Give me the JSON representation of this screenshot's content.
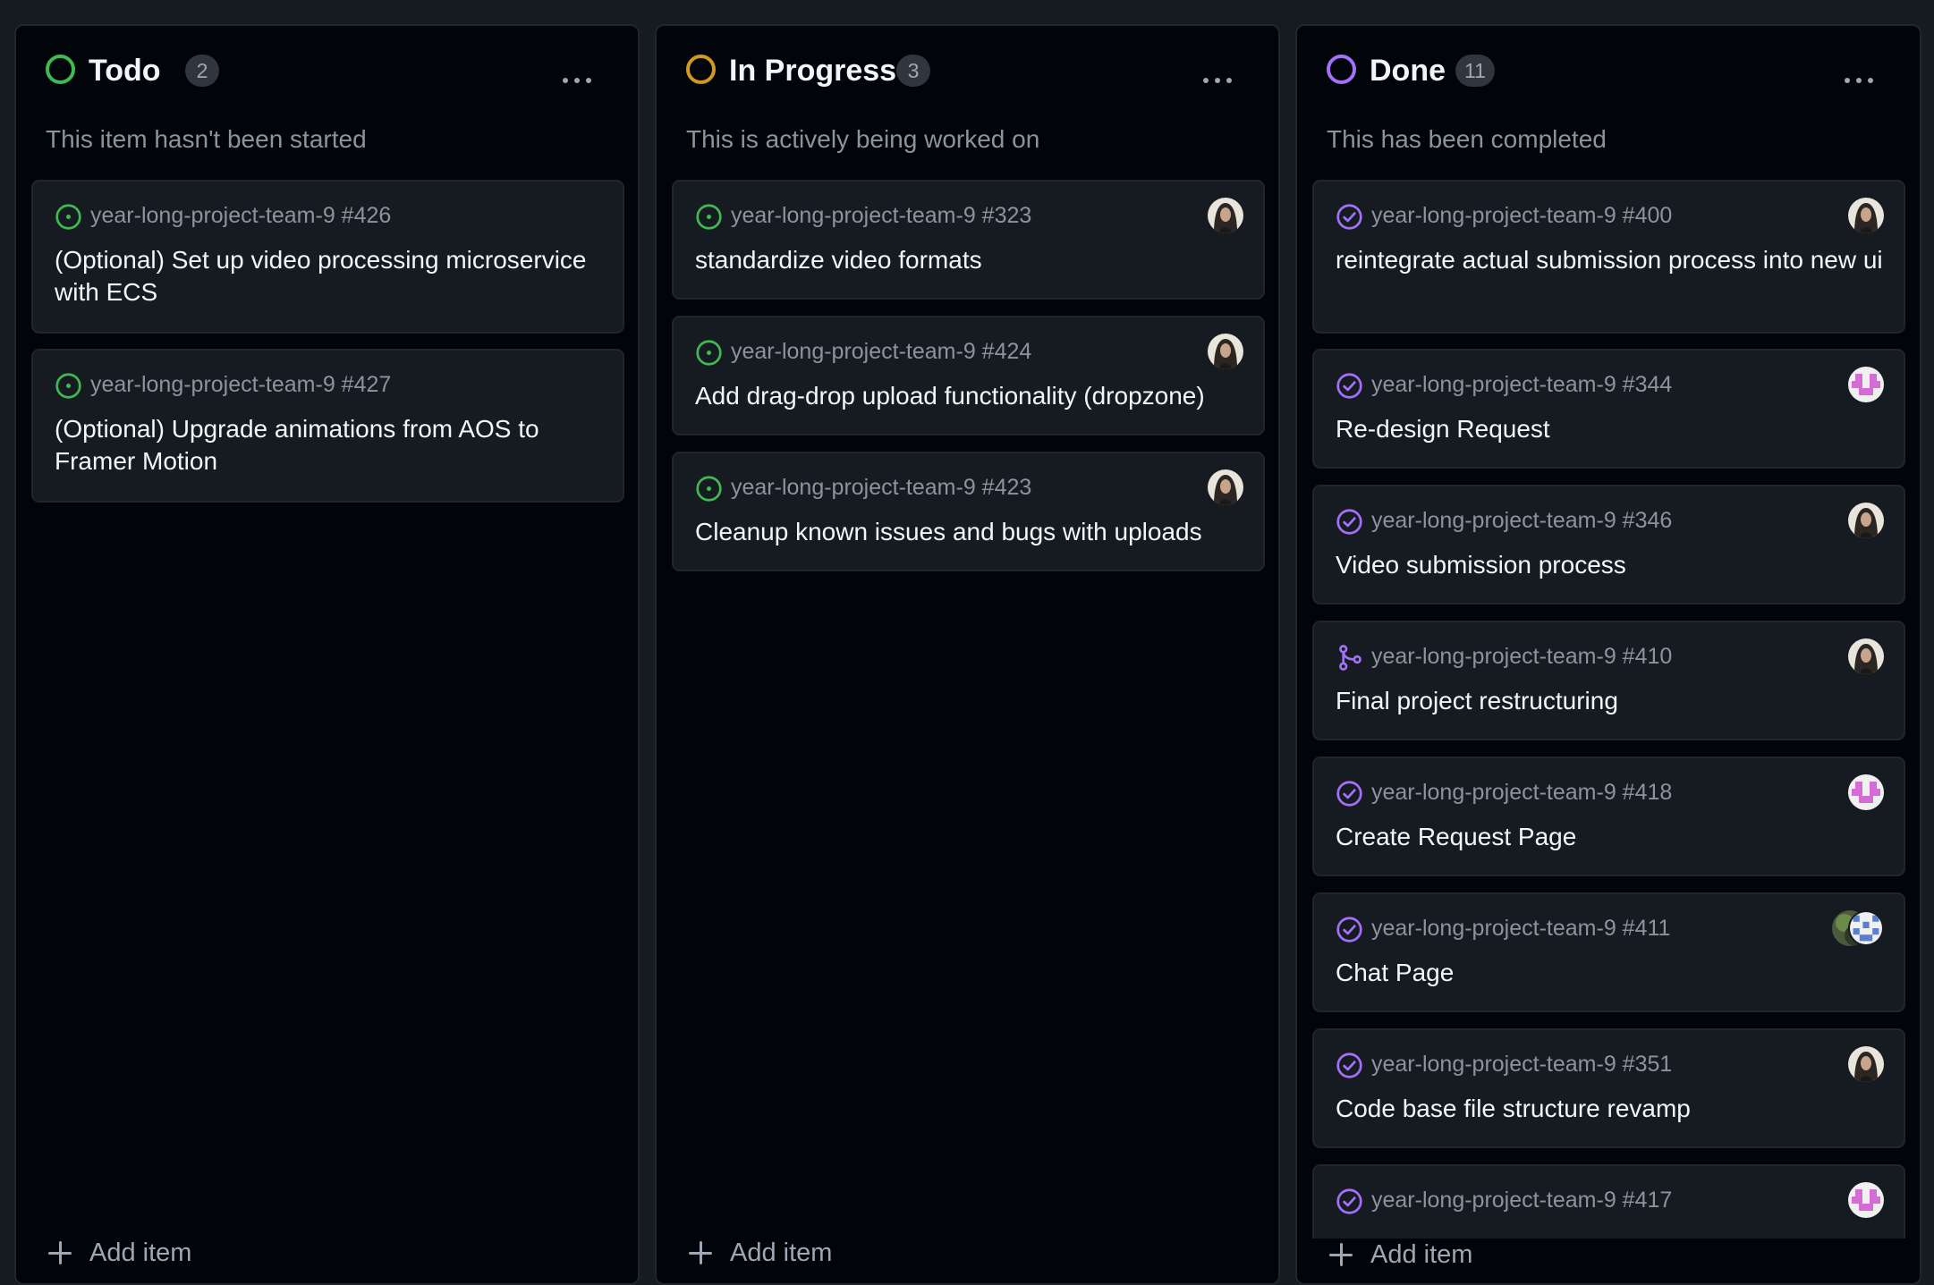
{
  "colors": {
    "background": "#161b22",
    "column_background": "#010409",
    "card_background": "#161b22",
    "todo_status": "#3fb950",
    "in_progress_status": "#d29922",
    "done_status": "#a371f7",
    "open_issue_icon": "#3fb950",
    "closed_issue_icon": "#a371f7",
    "merged_pr_icon": "#a371f7"
  },
  "columns": [
    {
      "title": "Todo",
      "count": "2",
      "status_color": "#3fb950",
      "description": "This item hasn't been started",
      "add_label": "Add item",
      "cards": [
        {
          "ref": "year-long-project-team-9 #426",
          "title": "(Optional) Set up video processing microservice with ECS",
          "icon": "open-issue-icon",
          "avatar": "none"
        },
        {
          "ref": "year-long-project-team-9 #427",
          "title": "(Optional) Upgrade animations from AOS to Framer Motion",
          "icon": "open-issue-icon",
          "avatar": "none"
        }
      ]
    },
    {
      "title": "In Progress",
      "count": "3",
      "status_color": "#d29922",
      "description": "This is actively being worked on",
      "add_label": "Add item",
      "cards": [
        {
          "ref": "year-long-project-team-9 #323",
          "title": "standardize video formats",
          "icon": "open-issue-icon",
          "avatar": "photo"
        },
        {
          "ref": "year-long-project-team-9 #424",
          "title": "Add drag-drop upload functionality (dropzone)",
          "icon": "open-issue-icon",
          "avatar": "photo"
        },
        {
          "ref": "year-long-project-team-9 #423",
          "title": "Cleanup known issues and bugs with uploads",
          "icon": "open-issue-icon",
          "avatar": "photo"
        }
      ]
    },
    {
      "title": "Done",
      "count": "11",
      "status_color": "#a371f7",
      "description": "This has been completed",
      "add_label": "Add item",
      "cards": [
        {
          "ref": "year-long-project-team-9 #400",
          "title": "reintegrate actual submission process into new ui",
          "icon": "closed-issue-icon",
          "avatar": "photo"
        },
        {
          "ref": "year-long-project-team-9 #344",
          "title": "Re-design Request",
          "icon": "closed-issue-icon",
          "avatar": "pink-identicon"
        },
        {
          "ref": "year-long-project-team-9 #346",
          "title": "Video submission process",
          "icon": "closed-issue-icon",
          "avatar": "photo"
        },
        {
          "ref": "year-long-project-team-9 #410",
          "title": "Final project restructuring",
          "icon": "merged-pr-icon",
          "avatar": "photo"
        },
        {
          "ref": "year-long-project-team-9 #418",
          "title": "Create Request Page",
          "icon": "closed-issue-icon",
          "avatar": "pink-identicon"
        },
        {
          "ref": "year-long-project-team-9 #411",
          "title": "Chat Page",
          "icon": "closed-issue-icon",
          "avatar": "avatar-pair"
        },
        {
          "ref": "year-long-project-team-9 #351",
          "title": "Code base file structure revamp",
          "icon": "closed-issue-icon",
          "avatar": "photo"
        },
        {
          "ref": "year-long-project-team-9 #417",
          "title": "",
          "icon": "closed-issue-icon",
          "avatar": "pink-identicon"
        }
      ]
    }
  ]
}
